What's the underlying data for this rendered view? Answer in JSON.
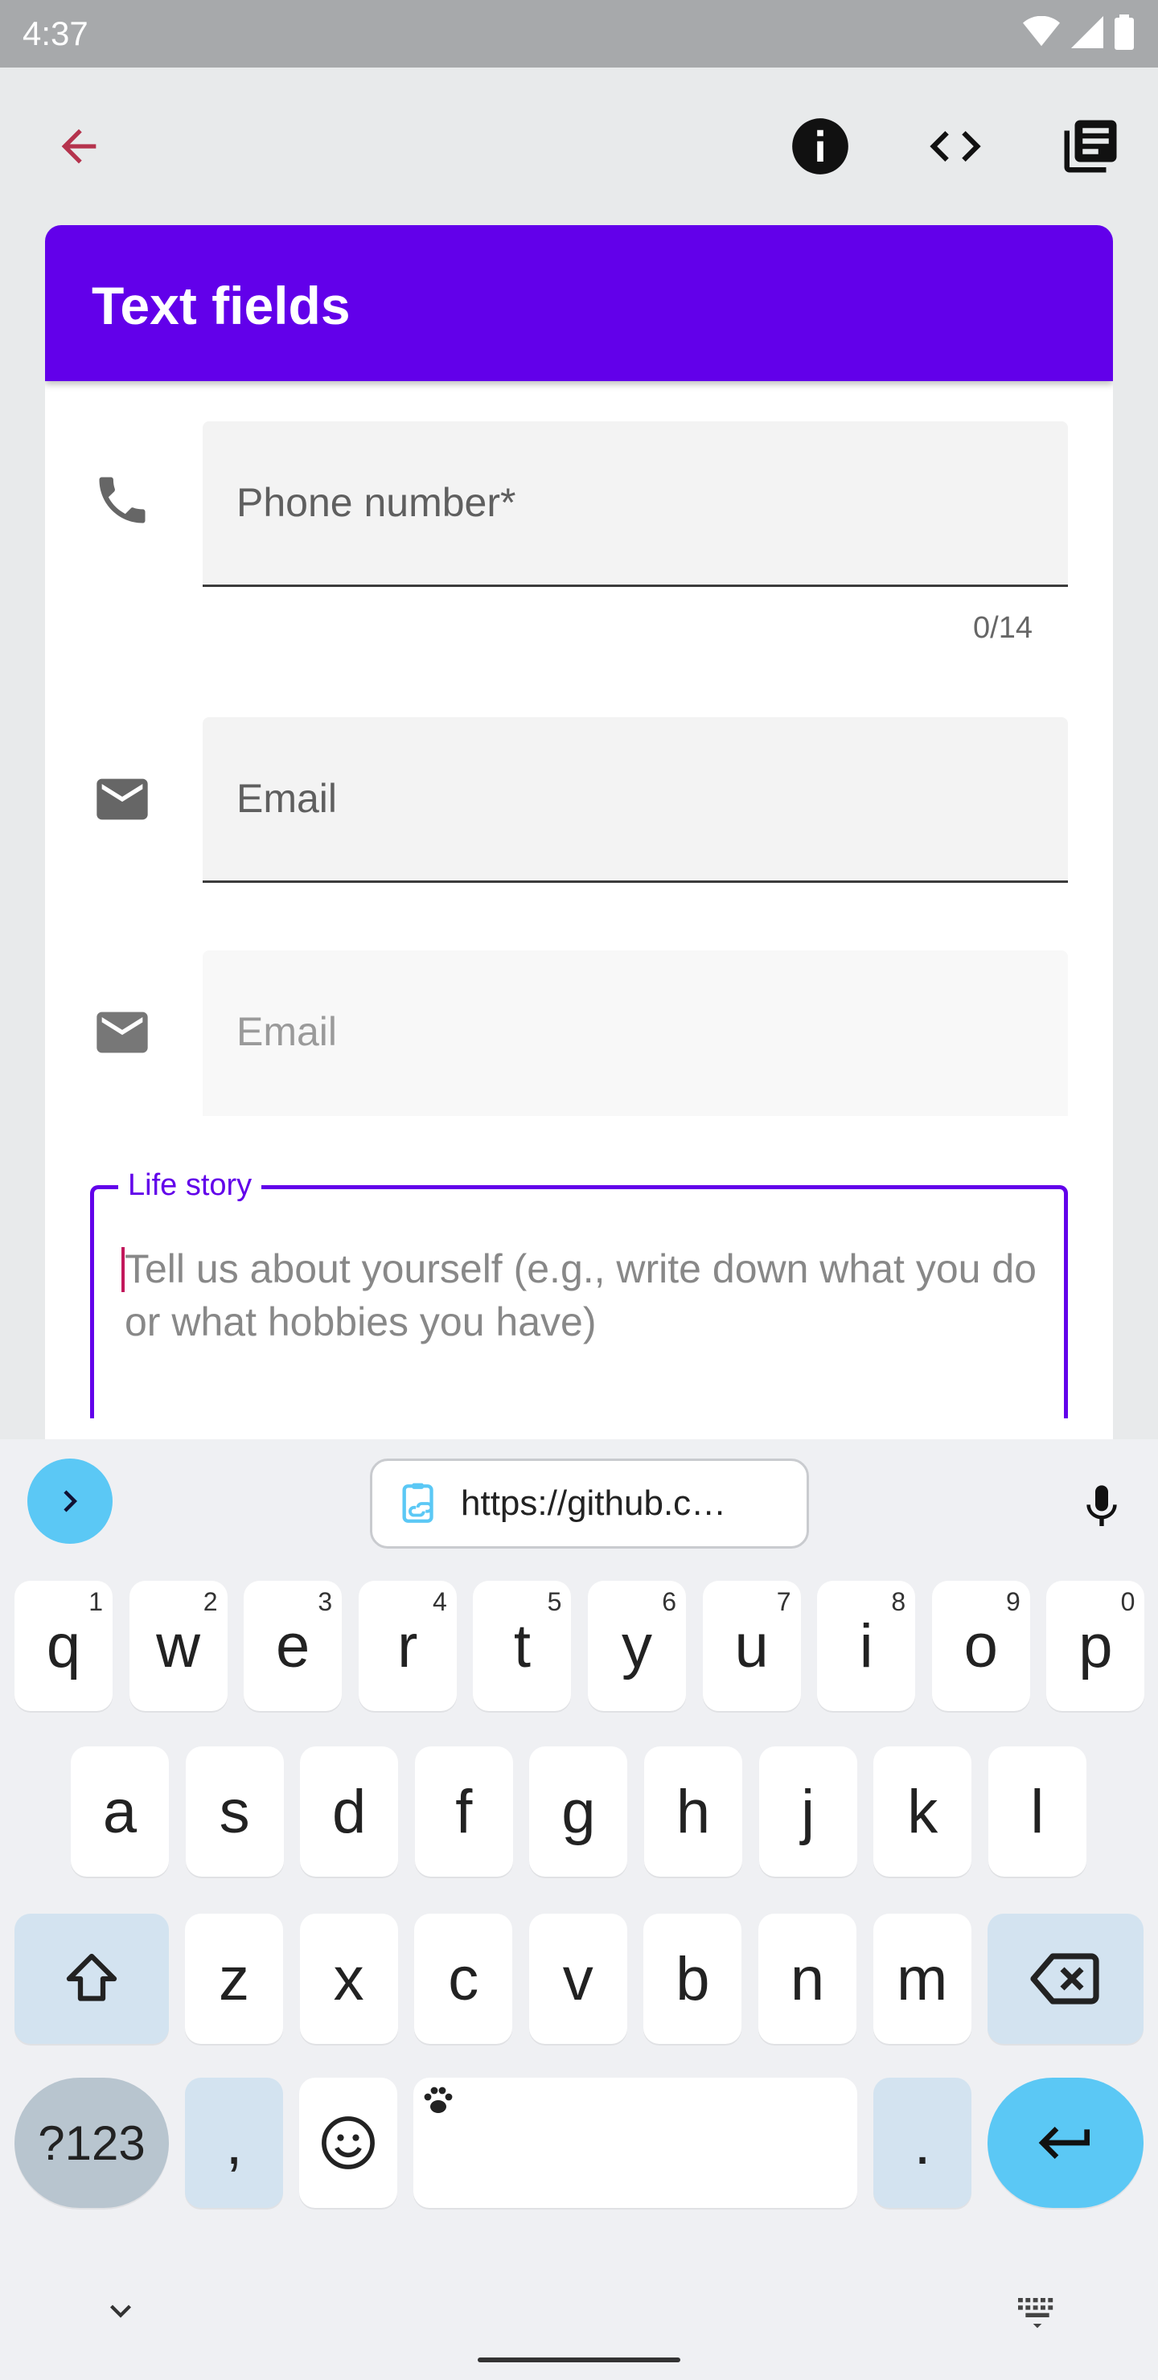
{
  "status_bar": {
    "time": "4:37"
  },
  "app_bar": {
    "back_icon": "arrow-back-icon",
    "actions": [
      "info-icon",
      "code-icon",
      "library-books-icon"
    ]
  },
  "card": {
    "title": "Text fields",
    "phone_field": {
      "label": "Phone number*",
      "counter": "0/14",
      "icon": "phone-icon"
    },
    "email_field": {
      "label": "Email",
      "icon": "mail-icon"
    },
    "email_field_disabled": {
      "label": "Email",
      "icon": "mail-icon"
    },
    "life_story": {
      "label": "Life story",
      "placeholder": "Tell us about yourself (e.g., write down what you do or what hobbies you have)"
    }
  },
  "keyboard": {
    "clipboard_suggestion": "https://github.c…",
    "row1": [
      {
        "k": "q",
        "h": "1"
      },
      {
        "k": "w",
        "h": "2"
      },
      {
        "k": "e",
        "h": "3"
      },
      {
        "k": "r",
        "h": "4"
      },
      {
        "k": "t",
        "h": "5"
      },
      {
        "k": "y",
        "h": "6"
      },
      {
        "k": "u",
        "h": "7"
      },
      {
        "k": "i",
        "h": "8"
      },
      {
        "k": "o",
        "h": "9"
      },
      {
        "k": "p",
        "h": "0"
      }
    ],
    "row2": [
      "a",
      "s",
      "d",
      "f",
      "g",
      "h",
      "j",
      "k",
      "l"
    ],
    "row3": [
      "z",
      "x",
      "c",
      "v",
      "b",
      "n",
      "m"
    ],
    "symbols_label": "?123",
    "comma": ",",
    "period": "."
  },
  "colors": {
    "accent": "#6200ea",
    "keyboard_accent": "#5bc8f5",
    "back": "#b5334d"
  }
}
